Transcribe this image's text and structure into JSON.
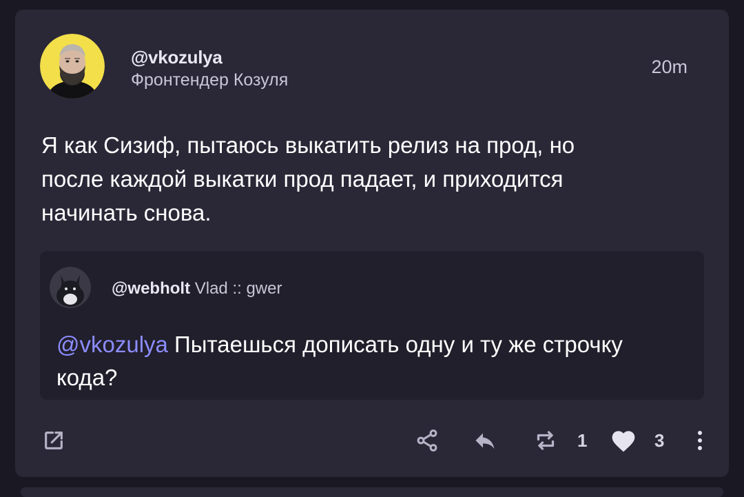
{
  "post": {
    "author_handle": "@vkozulya",
    "author_display_name": "Фронтендер Козуля",
    "timestamp": "20m",
    "text": "Я как Сизиф, пытаюсь выкатить релиз на прод, но\nпосле каждой выкатки прод падает, и приходится\nначинать снова."
  },
  "quote": {
    "author_handle": "@webholt",
    "author_display_name": "Vlad :: gwer",
    "mention": "@vkozulya",
    "text": " Пытаешься дописать одну и ту же строчку кода?"
  },
  "actions": {
    "boost_count": "1",
    "favourite_count": "3"
  },
  "icons": {
    "open": "open-in-new-icon",
    "share": "share-icon",
    "reply": "reply-icon",
    "boost": "repeat-icon",
    "favourite": "heart-icon",
    "more": "more-vertical-icon"
  },
  "colors": {
    "background": "#1a1923",
    "card": "#2a2837",
    "quote_card": "#201f2b",
    "mention": "#8c8cff",
    "avatar_bg": "#f2df4a"
  }
}
